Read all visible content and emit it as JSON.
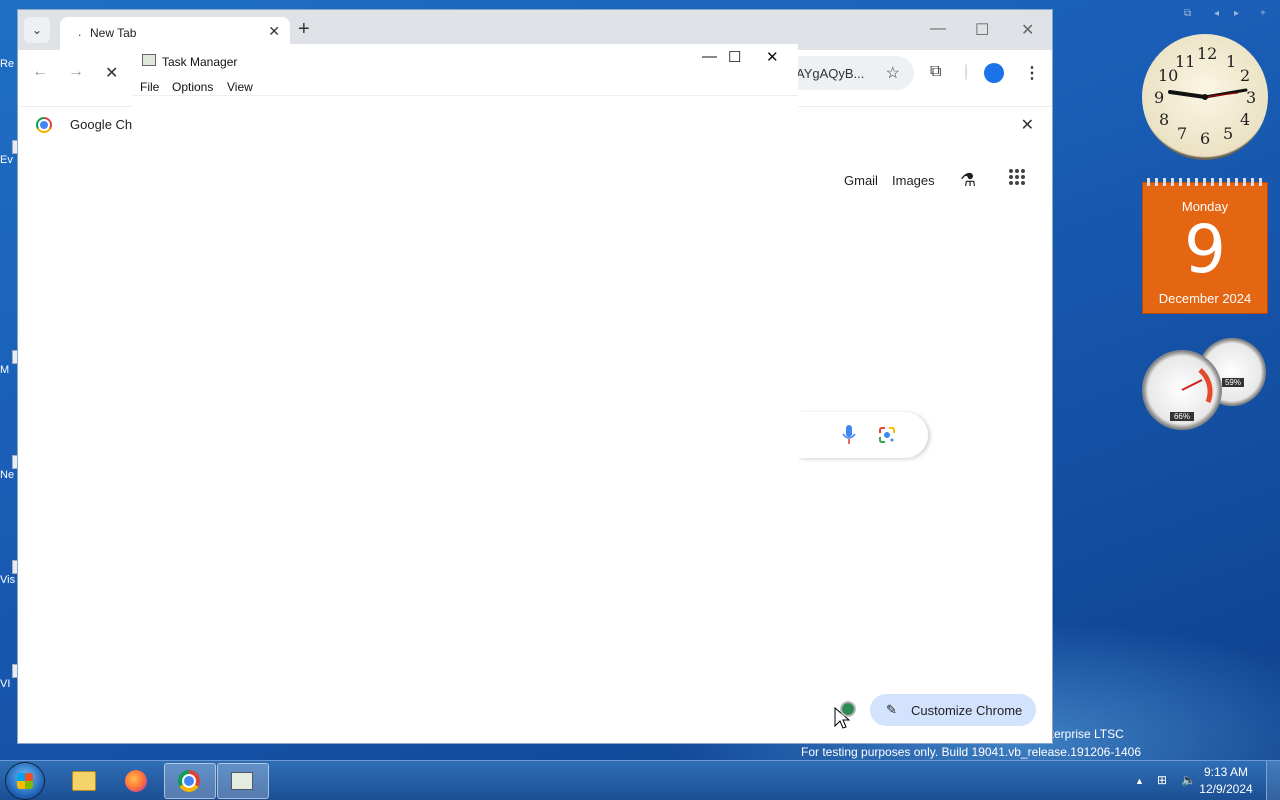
{
  "browser": {
    "tab_title": "New Tab",
    "tab_dot": ".",
    "tab_close": "✕",
    "new_tab": "+",
    "tab_search": "⌄",
    "window_controls": {
      "minimize": "—",
      "maximize": "☐",
      "close": "✕"
    },
    "toolbar": {
      "back": "←",
      "forward": "→",
      "stop": "✕",
      "url_fragment": "AYgAQyB...",
      "bookmark_star": "☆",
      "extensions": "⧉",
      "menu": "⋮"
    },
    "banner": {
      "text": "Google Ch",
      "close": "✕"
    },
    "google_nav": {
      "gmail": "Gmail",
      "images": "Images",
      "labs": "⚗",
      "apps": "⋮⋮⋮"
    },
    "customize_label": "Customize Chrome",
    "customize_icon": "✎"
  },
  "task_manager": {
    "title": "Task Manager",
    "controls": {
      "minimize": "—",
      "maximize": "☐",
      "close": "✕"
    },
    "menu": [
      "File",
      "Options",
      "View"
    ]
  },
  "gadgets": {
    "clock_numbers": [
      "12",
      "1",
      "2",
      "3",
      "4",
      "5",
      "6",
      "7",
      "8",
      "9",
      "10",
      "11"
    ],
    "calendar": {
      "weekday": "Monday",
      "day": "9",
      "month_year": "December 2024"
    },
    "cpu_percent": "66%",
    "mem_percent": "59%"
  },
  "watermark": {
    "line1": "nterprise LTSC",
    "line2": "For testing purposes only. Build 19041.vb_release.191206-1406"
  },
  "desktop_icon_labels": [
    "Re",
    "Ev",
    "M",
    "Ne",
    "Vis",
    "VI"
  ],
  "taskbar": {
    "time": "9:13 AM",
    "date": "12/9/2024",
    "tray_arrow": "▲",
    "network": "⊞",
    "volume": "🔈"
  }
}
